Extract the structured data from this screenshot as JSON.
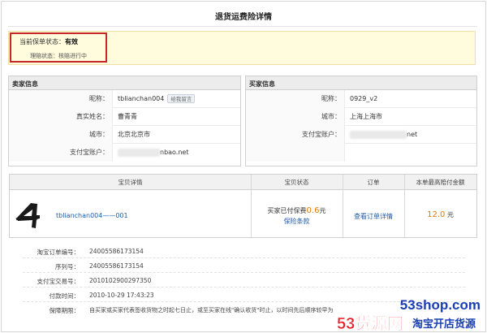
{
  "page": {
    "title": "退货运费险详情"
  },
  "status": {
    "label": "当前保单状态：",
    "value": "有效",
    "sub_label": "理赔状态：",
    "sub_value": "核赔进行中"
  },
  "seller": {
    "heading": "卖家信息",
    "rows": [
      {
        "label": "昵称：",
        "value": "tblianchan004",
        "badge": "给我留言"
      },
      {
        "label": "真实姓名：",
        "value": "曹青青"
      },
      {
        "label": "城市：",
        "value": "北京北京市"
      },
      {
        "label": "支付宝账户：",
        "value": "nbao.net"
      }
    ]
  },
  "buyer": {
    "heading": "买家信息",
    "rows": [
      {
        "label": "昵称：",
        "value": "0929_v2"
      },
      {
        "label": "城市：",
        "value": "上海上海市"
      },
      {
        "label": "支付宝账户：",
        "value": "net"
      }
    ]
  },
  "item_table": {
    "headers": [
      "宝贝详情",
      "宝贝状态",
      "订单",
      "本单最高赔付金额"
    ],
    "item_name": "tblianchan004——001",
    "state_prefix": "买家已付保费",
    "state_amount": "0.6",
    "state_unit": "元",
    "policy_link": "保险条款",
    "order_link": "查看订单详情",
    "max_payout": "12.0",
    "max_unit": "元"
  },
  "details": [
    {
      "label": "淘宝订单编号：",
      "value": "24005586173154"
    },
    {
      "label": "序列号：",
      "value": "24005586173154"
    },
    {
      "label": "支付宝交易号：",
      "value": "2010102900297350"
    },
    {
      "label": "付款时间：",
      "value": "2010-10-29 17:43:23"
    },
    {
      "label": "保障期限：",
      "value": "自买家或买家代表签收货物之时起七日止，或至买家在线\"确认收货\"时止，以时间先后顺序较早为"
    }
  ],
  "watermark": {
    "url": "53shop.com",
    "brand": "53货源网",
    "tagline": "淘宝开店货源"
  },
  "colors": {
    "status_border": "#c62828",
    "link": "#1e5aa8",
    "price": "#e57a00",
    "banner_bg": "#fffbdc"
  }
}
